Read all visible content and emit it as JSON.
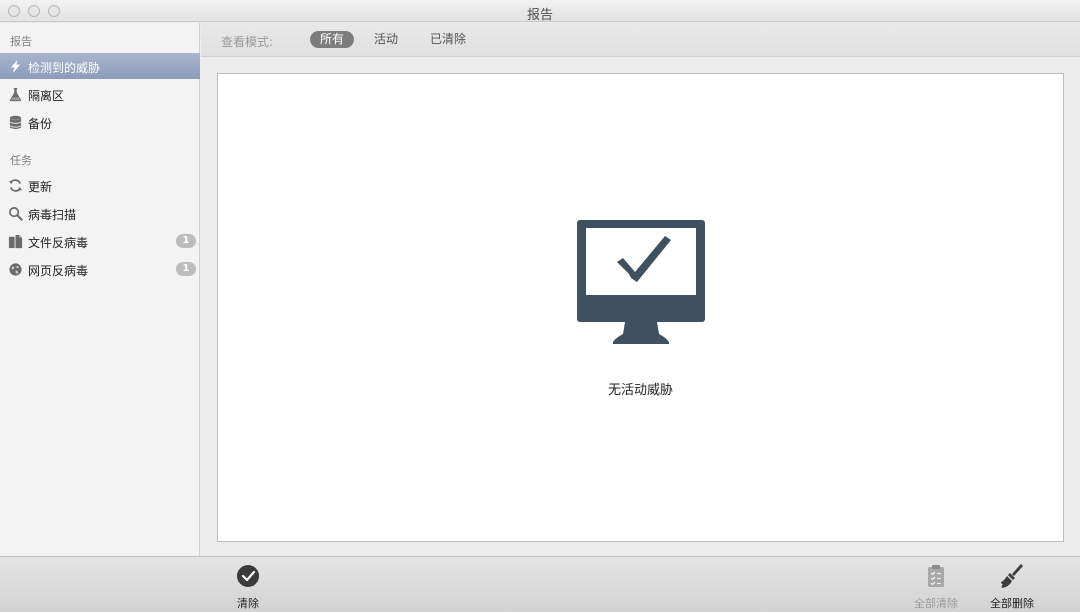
{
  "window": {
    "title": "报告"
  },
  "sidebar": {
    "sections": [
      {
        "header": "报告",
        "items": [
          {
            "label": "检测到的威胁",
            "icon": "lightning-icon",
            "selected": true
          },
          {
            "label": "隔离区",
            "icon": "flask-icon"
          },
          {
            "label": "备份",
            "icon": "database-icon"
          }
        ]
      },
      {
        "header": "任务",
        "items": [
          {
            "label": "更新",
            "icon": "refresh-icon"
          },
          {
            "label": "病毒扫描",
            "icon": "search-icon"
          },
          {
            "label": "文件反病毒",
            "icon": "documents-icon",
            "badge": "1"
          },
          {
            "label": "网页反病毒",
            "icon": "globe-icon",
            "badge": "1"
          }
        ]
      }
    ]
  },
  "filter": {
    "label": "查看模式:",
    "options": [
      "所有",
      "活动",
      "已清除"
    ],
    "selected": "所有"
  },
  "content": {
    "icon": "monitor-check-icon",
    "message": "无活动威胁"
  },
  "toolbar": {
    "clean": {
      "label": "清除",
      "icon": "check-circle-icon"
    },
    "clean_all": {
      "label": "全部清除",
      "icon": "clipboard-checklist-icon",
      "disabled": true
    },
    "delete_all": {
      "label": "全部删除",
      "icon": "broom-icon"
    }
  },
  "colors": {
    "selection": "#8c9cba",
    "monitor": "#3d5160",
    "badge": "#bdbdbd"
  }
}
